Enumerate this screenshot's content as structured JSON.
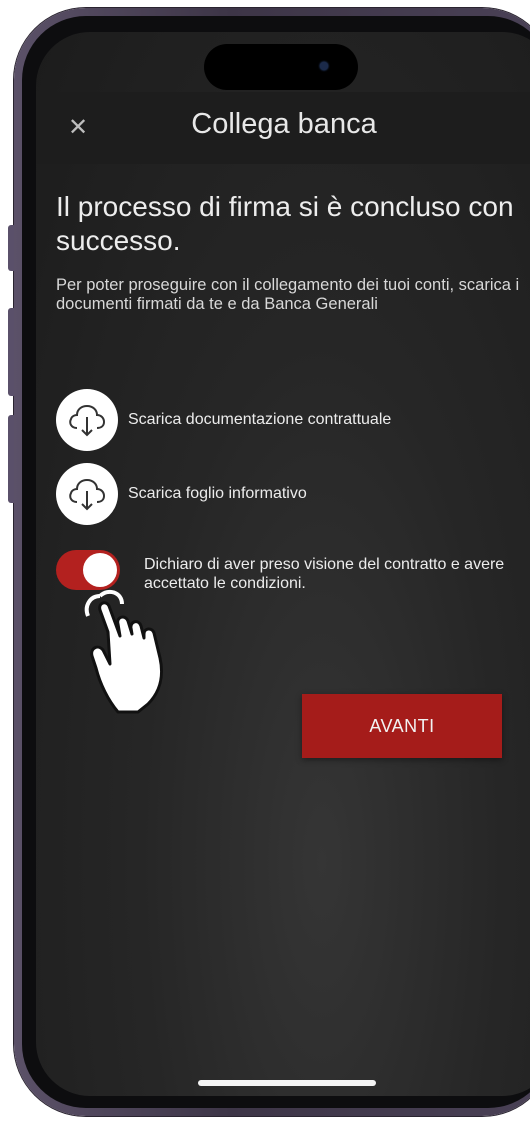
{
  "header": {
    "title": "Collega banca",
    "close_glyph": "✕"
  },
  "main": {
    "headline": "Il processo di firma si è concluso con successo.",
    "intro": "Per poter proseguire con il collegamento dei tuoi conti, scarica i documenti firmati da te e da Banca Generali",
    "downloads": [
      {
        "label": "Scarica documentazione contrattuale",
        "icon": "cloud-download-icon"
      },
      {
        "label": "Scarica foglio informativo",
        "icon": "cloud-download-icon"
      }
    ],
    "consent": {
      "text": "Dichiaro di aver preso visione del contratto e avere accettato le condizioni.",
      "checked": true
    },
    "next_label": "AVANTI"
  },
  "colors": {
    "accent_red": "#a51c1a",
    "toggle_red": "#b3211f",
    "background": "#262626"
  }
}
